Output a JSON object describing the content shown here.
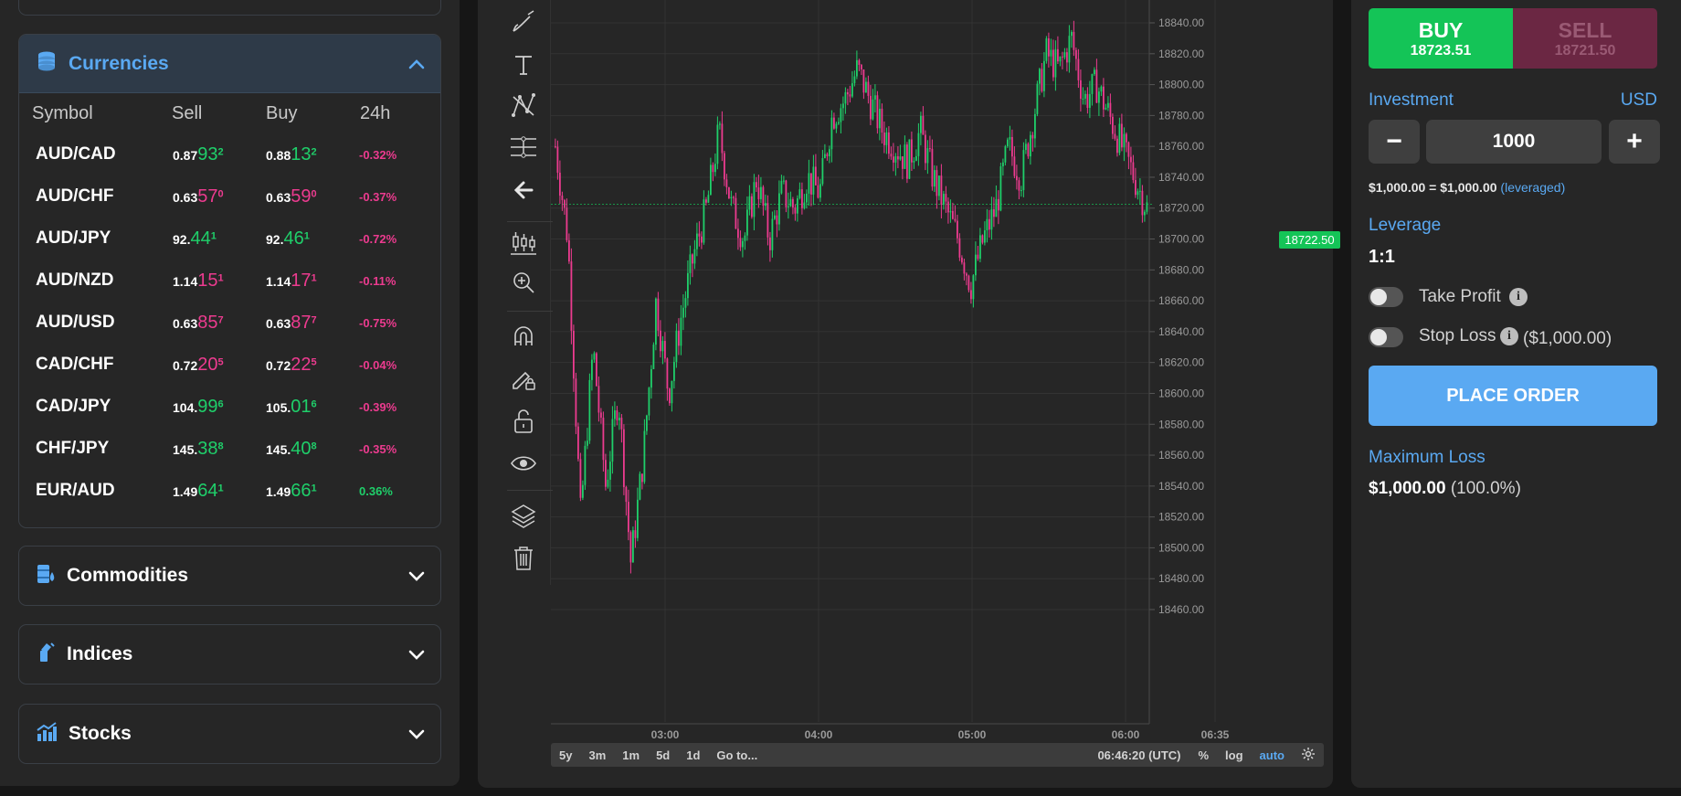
{
  "sidebar": {
    "accordions": [
      {
        "title": "Currencies",
        "icon": "coins-icon",
        "expanded": true
      },
      {
        "title": "Commodities",
        "icon": "oil-barrel-icon",
        "expanded": false
      },
      {
        "title": "Indices",
        "icon": "indices-icon",
        "expanded": false
      },
      {
        "title": "Stocks",
        "icon": "bar-chart-icon",
        "expanded": false
      }
    ],
    "columns": [
      "Symbol",
      "Sell",
      "Buy",
      "24h"
    ],
    "rows": [
      {
        "symbol": "AUD/CAD",
        "sell_pre": "0.87",
        "sell_big": "93",
        "sell_sup": "2",
        "sell_dir": "pos",
        "buy_pre": "0.88",
        "buy_big": "13",
        "buy_sup": "2",
        "buy_dir": "pos",
        "change": "-0.32%",
        "change_dir": "neg"
      },
      {
        "symbol": "AUD/CHF",
        "sell_pre": "0.63",
        "sell_big": "57",
        "sell_sup": "0",
        "sell_dir": "neg",
        "buy_pre": "0.63",
        "buy_big": "59",
        "buy_sup": "0",
        "buy_dir": "neg",
        "change": "-0.37%",
        "change_dir": "neg"
      },
      {
        "symbol": "AUD/JPY",
        "sell_pre": "92.",
        "sell_big": "44",
        "sell_sup": "1",
        "sell_dir": "pos",
        "buy_pre": "92.",
        "buy_big": "46",
        "buy_sup": "1",
        "buy_dir": "pos",
        "change": "-0.72%",
        "change_dir": "neg"
      },
      {
        "symbol": "AUD/NZD",
        "sell_pre": "1.14",
        "sell_big": "15",
        "sell_sup": "1",
        "sell_dir": "neg",
        "buy_pre": "1.14",
        "buy_big": "17",
        "buy_sup": "1",
        "buy_dir": "neg",
        "change": "-0.11%",
        "change_dir": "neg"
      },
      {
        "symbol": "AUD/USD",
        "sell_pre": "0.63",
        "sell_big": "85",
        "sell_sup": "7",
        "sell_dir": "neg",
        "buy_pre": "0.63",
        "buy_big": "87",
        "buy_sup": "7",
        "buy_dir": "neg",
        "change": "-0.75%",
        "change_dir": "neg"
      },
      {
        "symbol": "CAD/CHF",
        "sell_pre": "0.72",
        "sell_big": "20",
        "sell_sup": "5",
        "sell_dir": "neg",
        "buy_pre": "0.72",
        "buy_big": "22",
        "buy_sup": "5",
        "buy_dir": "neg",
        "change": "-0.04%",
        "change_dir": "neg"
      },
      {
        "symbol": "CAD/JPY",
        "sell_pre": "104.",
        "sell_big": "99",
        "sell_sup": "6",
        "sell_dir": "pos",
        "buy_pre": "105.",
        "buy_big": "01",
        "buy_sup": "6",
        "buy_dir": "pos",
        "change": "-0.39%",
        "change_dir": "neg"
      },
      {
        "symbol": "CHF/JPY",
        "sell_pre": "145.",
        "sell_big": "38",
        "sell_sup": "8",
        "sell_dir": "pos",
        "buy_pre": "145.",
        "buy_big": "40",
        "buy_sup": "8",
        "buy_dir": "pos",
        "change": "-0.35%",
        "change_dir": "neg"
      },
      {
        "symbol": "EUR/AUD",
        "sell_pre": "1.49",
        "sell_big": "64",
        "sell_sup": "1",
        "sell_dir": "pos",
        "buy_pre": "1.49",
        "buy_big": "66",
        "buy_sup": "1",
        "buy_dir": "pos",
        "change": "0.36%",
        "change_dir": "pos"
      }
    ]
  },
  "chart": {
    "tools": [
      "brush-icon",
      "text-icon",
      "pattern-icon",
      "measure-icon",
      "back-arrow-icon",
      "candles-icon",
      "zoom-in-icon",
      "magnet-icon",
      "lock-pencil-icon",
      "unlock-icon",
      "eye-icon",
      "layers-icon",
      "trash-icon"
    ],
    "price_label": "18722.50",
    "bottom_bar": {
      "ranges": [
        "5y",
        "3m",
        "1m",
        "5d",
        "1d",
        "Go to..."
      ],
      "time": "06:46:20 (UTC)",
      "percent": "%",
      "log": "log",
      "auto": "auto"
    }
  },
  "chart_data": {
    "type": "candlestick",
    "y_ticks": [
      "18840.00",
      "18820.00",
      "18800.00",
      "18780.00",
      "18760.00",
      "18740.00",
      "18720.00",
      "18700.00",
      "18680.00",
      "18660.00",
      "18640.00",
      "18620.00",
      "18600.00",
      "18580.00",
      "18560.00",
      "18540.00",
      "18520.00",
      "18500.00",
      "18480.00",
      "18460.00"
    ],
    "x_ticks": [
      "03:00",
      "04:00",
      "05:00",
      "06:00",
      "06:35"
    ],
    "ylim": [
      18455,
      18855
    ],
    "current_price": 18722.5,
    "up_color": "#1fcf6a",
    "down_color": "#ec3b8f",
    "close_path": [
      18760,
      18700,
      18520,
      18630,
      18540,
      18600,
      18490,
      18560,
      18660,
      18600,
      18650,
      18690,
      18720,
      18770,
      18720,
      18700,
      18740,
      18700,
      18730,
      18720,
      18740,
      18730,
      18780,
      18790,
      18810,
      18790,
      18770,
      18760,
      18750,
      18770,
      18740,
      18720,
      18700,
      18670,
      18700,
      18720,
      18760,
      18740,
      18780,
      18820,
      18810,
      18830,
      18790,
      18800,
      18780,
      18760,
      18740,
      18720
    ]
  },
  "order": {
    "buy_label": "BUY",
    "buy_price": "18723.51",
    "sell_label": "SELL",
    "sell_price": "18721.50",
    "investment_label": "Investment",
    "currency": "USD",
    "minus": "−",
    "plus": "+",
    "investment_value": "1000",
    "leverage_note_main": "$1,000.00 = $1,000.00",
    "leverage_note_tag": "(leveraged)",
    "leverage_label": "Leverage",
    "leverage_value": "1:1",
    "take_profit_label": "Take Profit",
    "stop_loss_label": "Stop Loss",
    "stop_loss_amount": "($1,000.00)",
    "place_order": "PLACE ORDER",
    "max_loss_label": "Maximum Loss",
    "max_loss_value": "$1,000.00",
    "max_loss_pct": "(100.0%)"
  }
}
